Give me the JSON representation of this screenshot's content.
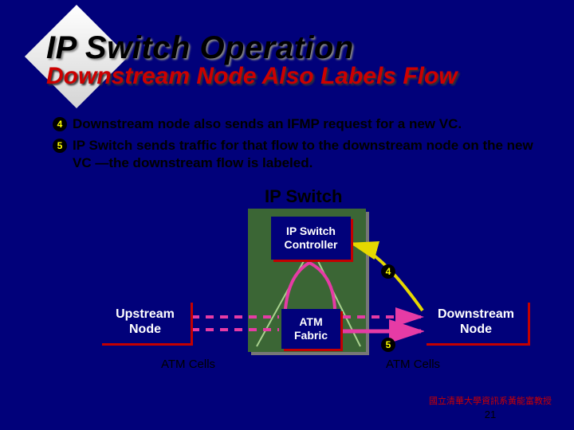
{
  "title": "IP Switch Operation",
  "subtitle": "Downstream Node Also Labels Flow",
  "bullets": [
    {
      "num": "4",
      "text": "Downstream node also sends an IFMP request for a new VC."
    },
    {
      "num": "5",
      "text": "IP Switch sends traffic for that flow to the downstream node on the new VC —the downstream flow is labeled."
    }
  ],
  "diagram": {
    "ip_switch_label": "IP Switch",
    "controller": "IP Switch Controller",
    "fabric": "ATM Fabric",
    "upstream": "Upstream Node",
    "downstream": "Downstream Node",
    "atm_cells_left": "ATM Cells",
    "atm_cells_right": "ATM Cells",
    "badge4": "4",
    "badge5": "5"
  },
  "footer": {
    "text": "國立清華大學資訊系黃能富教授",
    "page": "21"
  },
  "colors": {
    "bg": "#01017a",
    "accent_red": "#cc0000",
    "line_pink": "#e63ba5",
    "line_yellow": "#e6d800",
    "switch_green": "#3b6635"
  }
}
